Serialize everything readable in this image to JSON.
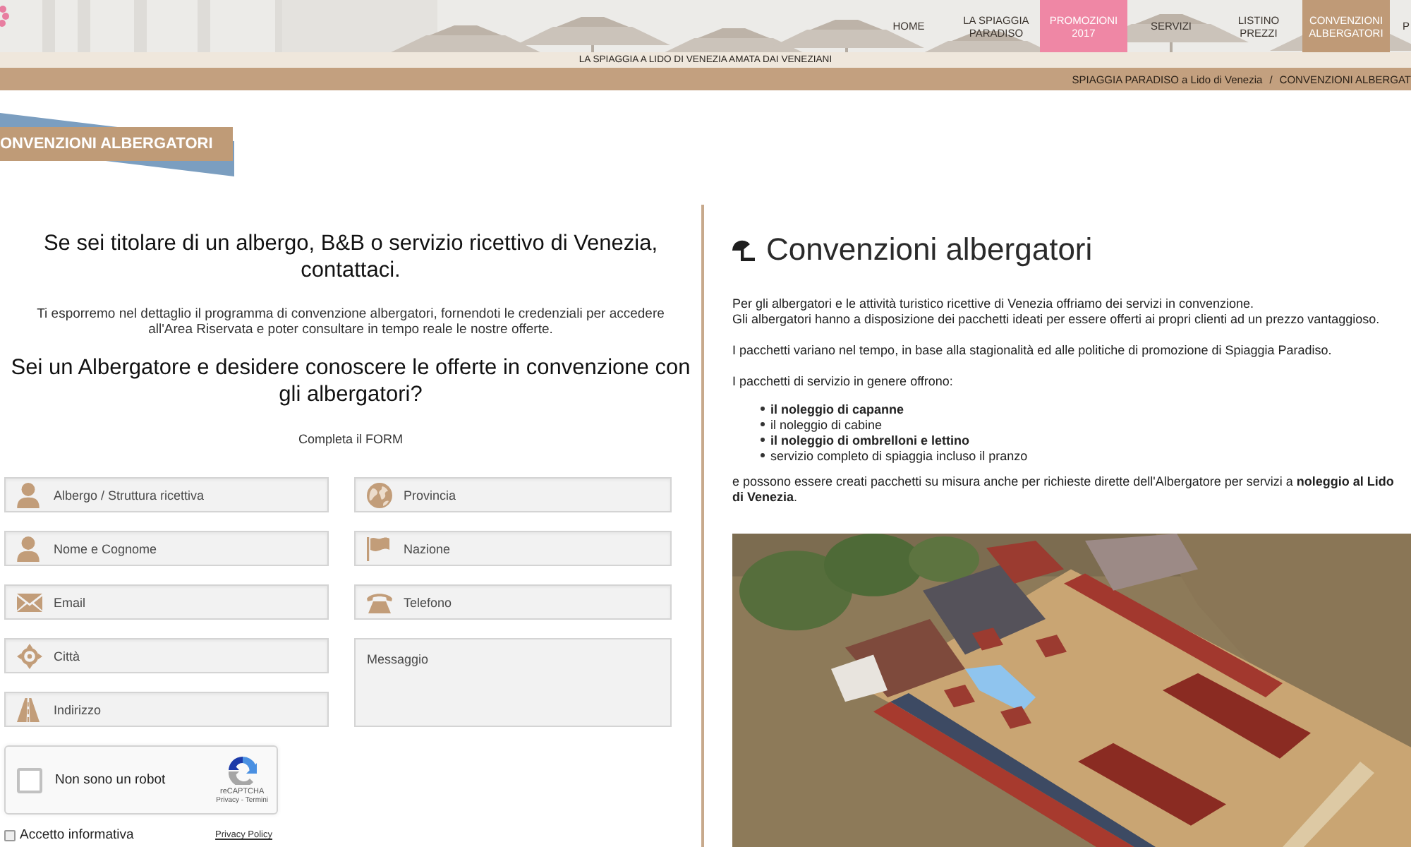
{
  "header": {
    "nav": [
      {
        "label": "HOME",
        "selected": false,
        "highlighted": false
      },
      {
        "label": "LA SPIAGGIA PARADISO",
        "selected": false,
        "highlighted": false
      },
      {
        "label": "PROMOZIONI 2017",
        "selected": false,
        "highlighted": true
      },
      {
        "label": "SERVIZI",
        "selected": false,
        "highlighted": false
      },
      {
        "label": "LISTINO PREZZI",
        "selected": false,
        "highlighted": false
      },
      {
        "label": "CONVENZIONI ALBERGATORI",
        "selected": true,
        "highlighted": false
      },
      {
        "label": "P",
        "selected": false,
        "highlighted": false
      }
    ],
    "tagline": "LA SPIAGGIA A LIDO DI VENEZIA AMATA DAI VENEZIANI",
    "breadcrumb": {
      "items": [
        "SPIAGGIA PARADISO a Lido di Venezia",
        "CONVENZIONI ALBERGAT"
      ],
      "separator": "/"
    }
  },
  "page_title": "ONVENZIONI ALBERGATORI",
  "contact": {
    "heading": "Se sei titolare di un albergo, B&B o servizio ricettivo di Venezia, contattaci.",
    "intro": "Ti esporremo nel dettaglio il programma di convenzione albergatori, fornendoti le credenziali per accedere all'Area Riservata e poter consultare in tempo reale le nostre offerte.",
    "question": "Sei un Albergatore e desidere conoscere le offerte in convenzione con gli albergatori?",
    "form_label": "Completa il FORM",
    "fields_left": [
      {
        "kind": "input",
        "placeholder": "Albergo / Struttura ricettiva"
      },
      {
        "kind": "input",
        "placeholder": "Nome e Cognome"
      },
      {
        "kind": "input",
        "placeholder": "Email"
      },
      {
        "kind": "input",
        "placeholder": "Città"
      },
      {
        "kind": "input",
        "placeholder": "Indirizzo"
      }
    ],
    "fields_right": [
      {
        "kind": "input",
        "placeholder": "Provincia"
      },
      {
        "kind": "input",
        "placeholder": "Nazione"
      },
      {
        "kind": "input",
        "placeholder": "Telefono"
      },
      {
        "kind": "textarea",
        "placeholder": "Messaggio"
      }
    ],
    "captcha": {
      "label": "Non sono un robot",
      "checked": false,
      "brand": "reCAPTCHA",
      "terms": "Privacy - Termini"
    },
    "consent": {
      "label": "Accetto informativa",
      "checked": false,
      "link": "Privacy Policy"
    }
  },
  "info": {
    "title": "Convenzioni albergatori",
    "paragraphs": [
      {
        "lines": [
          "Per gli albergatori e le attività turistico ricettive di Venezia offriamo dei servizi in convenzione.",
          "Gli albergatori hanno a disposizione dei pacchetti ideati per essere offerti ai propri clienti ad un prezzo vantaggioso."
        ]
      },
      {
        "lines": [
          "I pacchetti variano nel tempo, in base alla stagionalità ed alle politiche di promozione di Spiaggia Paradiso."
        ]
      },
      {
        "lines": [
          "I pacchetti di servizio in genere offrono:"
        ]
      }
    ],
    "list": [
      {
        "text": "il noleggio di capanne",
        "bold": true
      },
      {
        "text": "il noleggio di cabine",
        "bold": false
      },
      {
        "text": "il noleggio di ombrelloni e lettino",
        "bold": true
      },
      {
        "text": "servizio completo di spiaggia incluso il pranzo",
        "bold": false
      }
    ],
    "closing": "e possono essere creati pacchetti su misura anche per richieste dirette dell'Albergatore per servizi a **noleggio al Lido di Venezia**."
  }
}
